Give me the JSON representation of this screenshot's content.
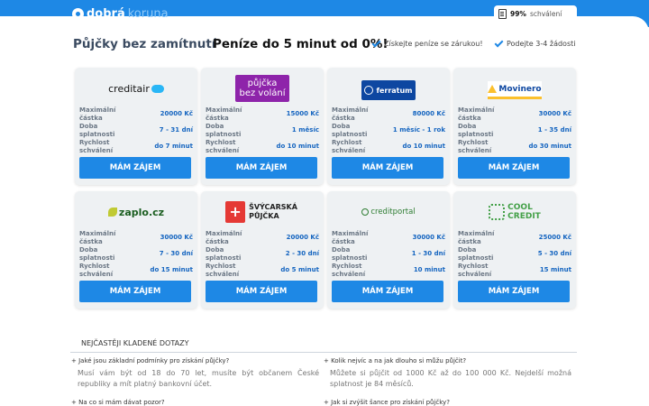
{
  "header": {
    "logo_part1": "dobrá",
    "logo_part2": "koruna",
    "rating_pct": "99%",
    "rating_text": "schválení"
  },
  "headline": {
    "title": "Půjčky bez zamítnutí",
    "subtitle": "Peníze do 5 minut od 0%!",
    "benefits": [
      "Získejte peníze se zárukou!",
      "Podejte 3-4 žádosti"
    ]
  },
  "labels": {
    "amount": "Maximální částka",
    "term": "Doba splatnosti",
    "speed": "Rychlost schválení",
    "button": "MÁM ZÁJEM"
  },
  "lenders": [
    {
      "logo": "creditair",
      "logo_color": "#111111",
      "logo_bg": "#ffffff",
      "amount": "20000 Kč",
      "term": "7 - 31 dní",
      "speed": "do 7 minut"
    },
    {
      "logo_line1": "půjčka",
      "logo_line2": "bez volání",
      "logo_color": "#ffffff",
      "logo_bg": "#8e24aa",
      "amount": "15000 Kč",
      "term": "1 měsíc",
      "speed": "do 10 minut"
    },
    {
      "logo": "ferratum",
      "logo_color": "#ffffff",
      "logo_bg": "#0d47a1",
      "amount": "80000 Kč",
      "term": "1 měsíc - 1 rok",
      "speed": "do 10 minut"
    },
    {
      "logo": "Movinero",
      "logo_color": "#0d47a1",
      "logo_bg": "#ffffff",
      "amount": "30000 Kč",
      "term": "1 - 35 dní",
      "speed": "do 30 minut"
    },
    {
      "logo": "zaplo.cz",
      "logo_color": "#1b5e20",
      "logo_bg": "#ffffff",
      "amount": "30000 Kč",
      "term": "7 - 30 dní",
      "speed": "do 15 minut"
    },
    {
      "logo_line1": "ŠVÝCARSKÁ",
      "logo_line2": "PŮJČKA",
      "logo_color": "#222222",
      "logo_bg": "#ffffff",
      "amount": "20000 Kč",
      "term": "2 - 30 dní",
      "speed": "do 5 minut"
    },
    {
      "logo": "creditportal",
      "logo_color": "#2e7d32",
      "logo_bg": "#ffffff",
      "amount": "30000 Kč",
      "term": "1 - 30 dní",
      "speed": "10 minut"
    },
    {
      "logo_line1": "COOL",
      "logo_line2": "CREDIT",
      "logo_color": "#43a047",
      "logo_bg": "#ffffff",
      "amount": "25000 Kč",
      "term": "5 - 30 dní",
      "speed": "15 minut"
    }
  ],
  "faq": {
    "heading": "NEJČASTĚJI KLADENÉ DOTAZY",
    "items": [
      {
        "q": "+ Jaké jsou základní podmínky pro získání půjčky?",
        "a": "Musí vám být od 18 do 70 let, musíte být občanem České republiky a mít platný bankovní účet."
      },
      {
        "q": "+ Kolik nejvíc a na jak dlouho si můžu půjčit?",
        "a": "Můžete si půjčit od 1000 Kč až do 100 000 Kč. Nejdelší možná splatnost je 84 měsíců."
      },
      {
        "q": "+ Na co si mám dávat pozor?",
        "a": ""
      },
      {
        "q": "+ Jak si zvýšit šance pro získání půjčky?",
        "a": ""
      }
    ]
  }
}
